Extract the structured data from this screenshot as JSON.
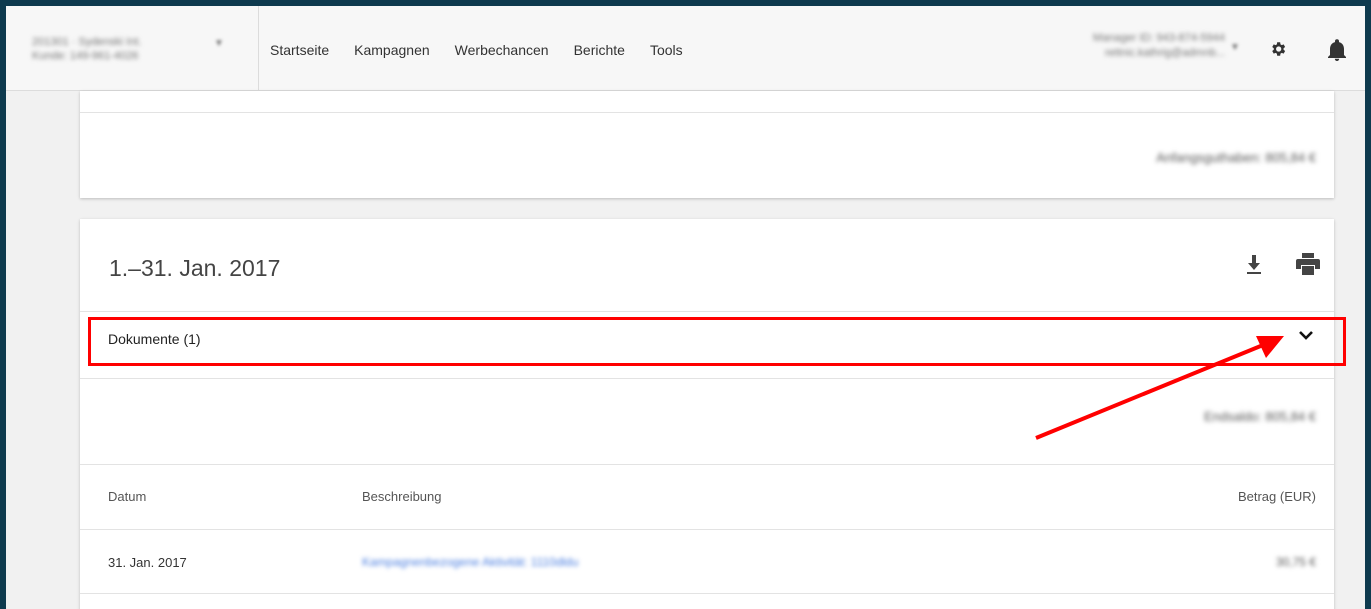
{
  "account": {
    "line1": "201301 · Sydenski Int.",
    "line2": "Kunde: 149-961-4026"
  },
  "nav": {
    "items": [
      "Startseite",
      "Kampagnen",
      "Werbechancen",
      "Berichte",
      "Tools"
    ]
  },
  "manager": {
    "line1": "Manager ID: 943-874-5944",
    "line2": "rettnic.kathrig@admnb..."
  },
  "icons": {
    "settings": "gear-icon",
    "notifications": "bell-icon",
    "download": "download-icon",
    "print": "print-icon",
    "expand": "chevron-down-icon"
  },
  "summary": {
    "starting_balance": "Anfangsguthaben: 805,84 €"
  },
  "statement": {
    "period": "1.–31. Jan. 2017",
    "documents_label": "Dokumente (1)",
    "ending_balance": "Endsaldo: 805,84 €",
    "columns": {
      "date": "Datum",
      "description": "Beschreibung",
      "amount": "Betrag (EUR)"
    },
    "rows": [
      {
        "date": "31. Jan. 2017",
        "description": "Kampagnenbezogene Aktivität: 1110dldu",
        "amount": "30,75 €"
      }
    ]
  },
  "colors": {
    "annotation": "#ff0000",
    "link": "#4a7ee0"
  }
}
